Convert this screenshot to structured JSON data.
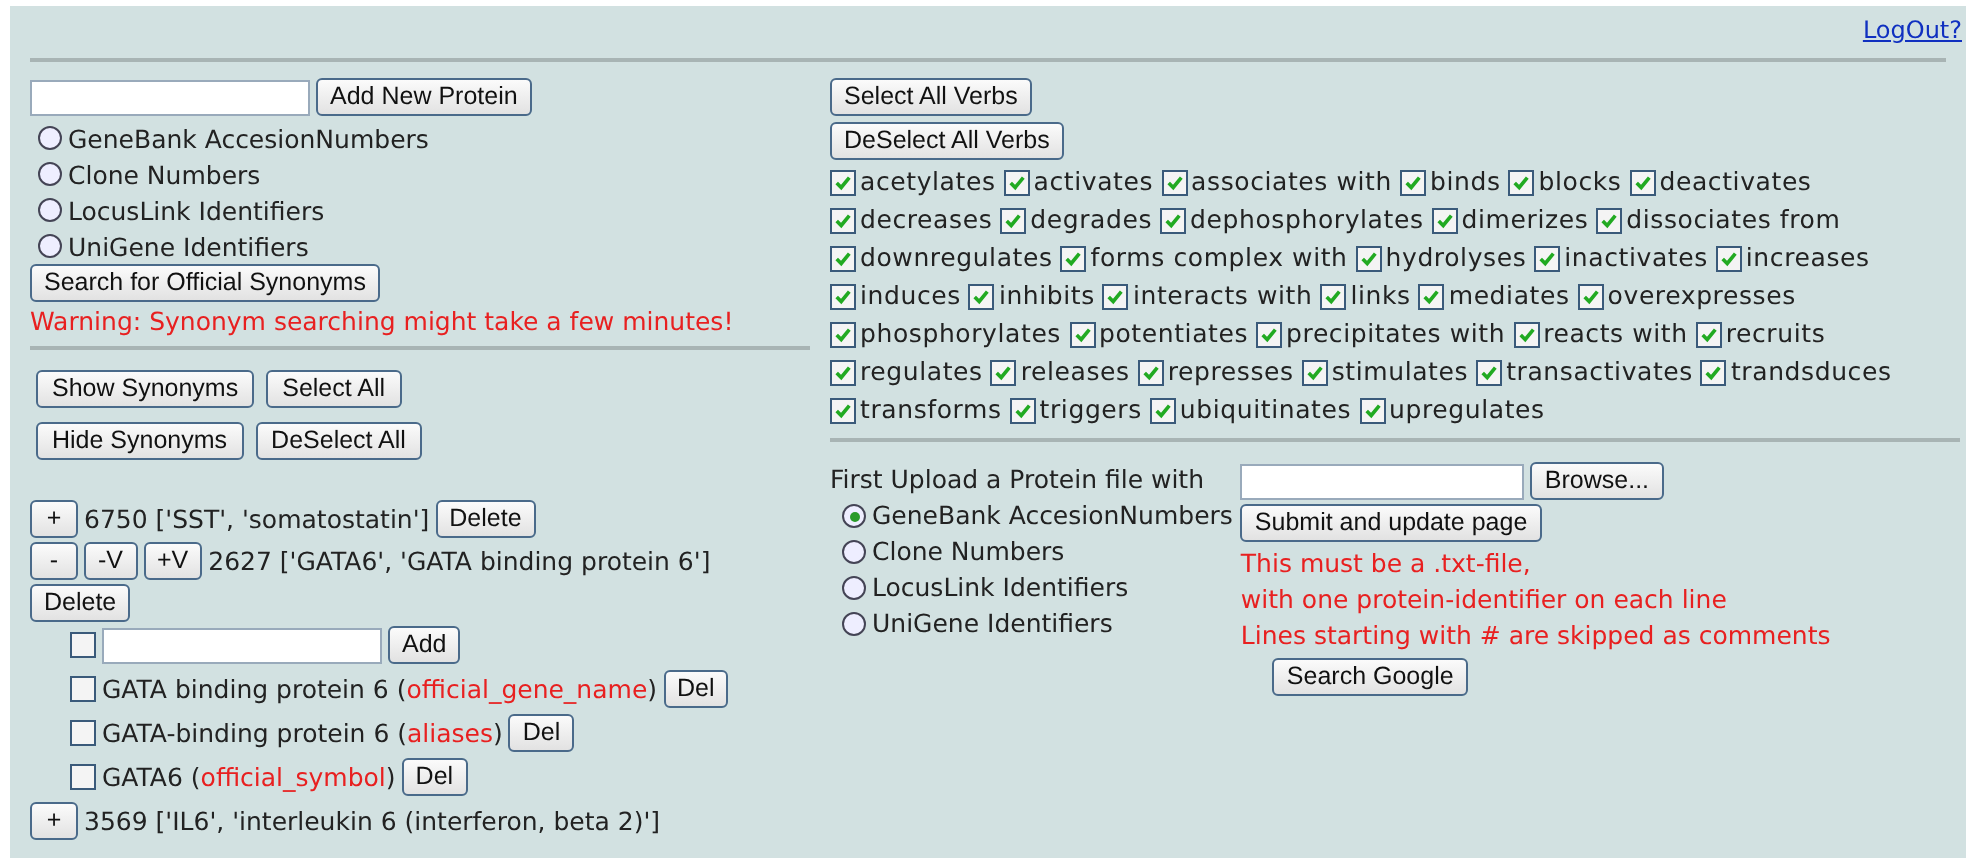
{
  "logout": "LogOut?",
  "add_protein": {
    "button": "Add New Protein"
  },
  "id_types": [
    {
      "label": "GeneBank AccesionNumbers",
      "selected": false
    },
    {
      "label": "Clone Numbers",
      "selected": false
    },
    {
      "label": "LocusLink Identifiers",
      "selected": false
    },
    {
      "label": "UniGene Identifiers",
      "selected": false
    }
  ],
  "search_synonyms_button": "Search for Official Synonyms",
  "warning": "Warning: Synonym searching might take a few minutes!",
  "synonym_buttons": [
    [
      "Show Synonyms",
      "Select All"
    ],
    [
      "Hide Synonyms",
      "DeSelect All"
    ]
  ],
  "proteins": [
    {
      "toggle": "+",
      "text": "6750 ['SST', 'somatostatin']",
      "delete": "Delete"
    },
    {
      "toggle": "-",
      "verb_buttons": [
        "-V",
        "+V"
      ],
      "text": "2627 ['GATA6', 'GATA binding protein 6']",
      "delete": "Delete",
      "add_button": "Add",
      "add_checked": false,
      "synonyms": [
        {
          "checked": false,
          "before": "GATA binding protein 6 (",
          "source": "official_gene_name",
          "after": ")",
          "delete": "Del"
        },
        {
          "checked": false,
          "before": "GATA-binding protein 6 (",
          "source": "aliases",
          "after": ")",
          "delete": "Del"
        },
        {
          "checked": false,
          "before": "GATA6 (",
          "source": "official_symbol",
          "after": ")",
          "delete": "Del"
        }
      ]
    },
    {
      "toggle": "+",
      "text": "3569 ['IL6', 'interleukin 6 (interferon, beta 2)']"
    }
  ],
  "verb_controls": [
    "Select All Verbs",
    "DeSelect All Verbs"
  ],
  "verbs": [
    {
      "label": "acetylates",
      "checked": true
    },
    {
      "label": "activates",
      "checked": true
    },
    {
      "label": "associates with",
      "checked": true
    },
    {
      "label": "binds",
      "checked": true
    },
    {
      "label": "blocks",
      "checked": true
    },
    {
      "label": "deactivates",
      "checked": true
    },
    {
      "label": "decreases",
      "checked": true
    },
    {
      "label": "degrades",
      "checked": true
    },
    {
      "label": "dephosphorylates",
      "checked": true
    },
    {
      "label": "dimerizes",
      "checked": true
    },
    {
      "label": "dissociates from",
      "checked": true
    },
    {
      "label": "downregulates",
      "checked": true
    },
    {
      "label": "forms complex with",
      "checked": true
    },
    {
      "label": "hydrolyses",
      "checked": true
    },
    {
      "label": "inactivates",
      "checked": true
    },
    {
      "label": "increases",
      "checked": true
    },
    {
      "label": "induces",
      "checked": true
    },
    {
      "label": "inhibits",
      "checked": true
    },
    {
      "label": "interacts with",
      "checked": true
    },
    {
      "label": "links",
      "checked": true
    },
    {
      "label": "mediates",
      "checked": true
    },
    {
      "label": "overexpresses",
      "checked": true
    },
    {
      "label": "phosphorylates",
      "checked": true
    },
    {
      "label": "potentiates",
      "checked": true
    },
    {
      "label": "precipitates with",
      "checked": true
    },
    {
      "label": "reacts with",
      "checked": true
    },
    {
      "label": "recruits",
      "checked": true
    },
    {
      "label": "regulates",
      "checked": true
    },
    {
      "label": "releases",
      "checked": true
    },
    {
      "label": "represses",
      "checked": true
    },
    {
      "label": "stimulates",
      "checked": true
    },
    {
      "label": "transactivates",
      "checked": true
    },
    {
      "label": "trandsduces",
      "checked": true
    },
    {
      "label": "transforms",
      "checked": true
    },
    {
      "label": "triggers",
      "checked": true
    },
    {
      "label": "ubiquitinates",
      "checked": true
    },
    {
      "label": "upregulates",
      "checked": true
    }
  ],
  "upload": {
    "label": "First Upload a Protein file with",
    "id_types": [
      {
        "label": "GeneBank AccesionNumbers",
        "selected": true
      },
      {
        "label": "Clone Numbers",
        "selected": false
      },
      {
        "label": "LocusLink Identifiers",
        "selected": false
      },
      {
        "label": "UniGene Identifiers",
        "selected": false
      }
    ],
    "browse_button": "Browse...",
    "submit_button": "Submit and update page",
    "notes": [
      "This must be a .txt-file,",
      "with one protein-identifier on each line",
      "Lines starting with # are skipped as comments"
    ],
    "google_button": "Search Google"
  }
}
